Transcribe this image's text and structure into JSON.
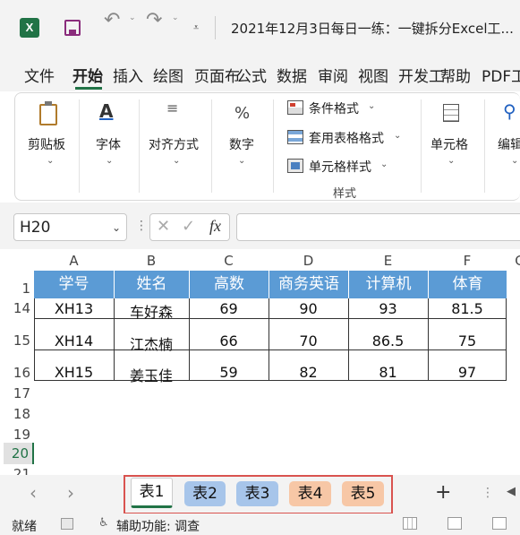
{
  "title_bar": {
    "doc_title": "2021年12月3日每日一练：一键拆分Excel工..."
  },
  "menu": {
    "items": [
      "文件",
      "开始",
      "插入",
      "绘图",
      "页面布",
      "公式",
      "数据",
      "审阅",
      "视图",
      "开发工",
      "帮助",
      "PDF工"
    ]
  },
  "ribbon": {
    "clipboard": "剪贴板",
    "font": "字体",
    "align": "对齐方式",
    "number": "数字",
    "cond_format": "条件格式",
    "table_format": "套用表格格式",
    "cell_style": "单元格样式",
    "styles_group": "样式",
    "cells": "单元格",
    "edit": "编辑"
  },
  "formula_bar": {
    "name_box": "H20",
    "fx": "fx",
    "formula": ""
  },
  "sheet": {
    "columns": [
      "A",
      "B",
      "C",
      "D",
      "E",
      "F",
      "G"
    ],
    "row_numbers": [
      "1",
      "14",
      "15",
      "16",
      "17",
      "18",
      "19",
      "20",
      "21"
    ],
    "headers": [
      "学号",
      "姓名",
      "高数",
      "商务英语",
      "计算机",
      "体育"
    ],
    "rows": [
      [
        "XH13",
        "车好森",
        "69",
        "90",
        "93",
        "81.5"
      ],
      [
        "XH14",
        "江杰楠",
        "66",
        "70",
        "86.5",
        "75"
      ],
      [
        "XH15",
        "姜玉佳",
        "59",
        "82",
        "81",
        "97"
      ]
    ]
  },
  "sheet_tabs": {
    "tabs": [
      "表1",
      "表2",
      "表3",
      "表4",
      "表5"
    ],
    "add": "+"
  },
  "status": {
    "ready": "就绪",
    "accessibility": "辅助功能: 调查"
  },
  "colors": {
    "header_fill": "#5b9bd5",
    "tab_blue": "#a7c5ea",
    "tab_orange": "#f7c7a6",
    "highlight": "#d9534f",
    "excel_green": "#217346"
  }
}
